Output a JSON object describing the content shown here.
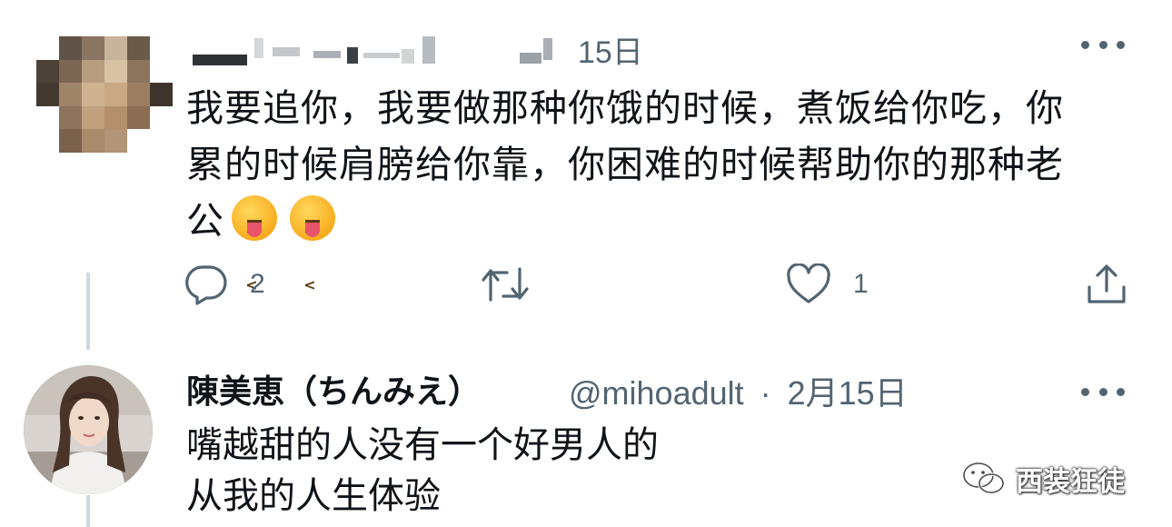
{
  "tweet1": {
    "time": "15日",
    "text_line1": "我要追你，我要做那种你饿的时候，煮饭给你吃，你",
    "text_line2": "累的时候肩膀给你靠，你困难的时候帮助你的那种老",
    "text_line3": "公",
    "emojis": [
      "squinting-tongue-emoji",
      "squinting-tongue-emoji"
    ],
    "reply_count": "2",
    "like_count": "1"
  },
  "tweet2": {
    "display_name": "陳美恵（ちんみえ）",
    "handle": "@mihoadult",
    "separator": "·",
    "date": "2月15日",
    "text_line1": "嘴越甜的人没有一个好男人的",
    "text_line2": "从我的人生体验"
  },
  "watermark": {
    "text": "西装狂徒"
  },
  "colors": {
    "secondary_text": "#536471",
    "primary_text": "#0f1419",
    "thread_line": "#cfd9de"
  }
}
